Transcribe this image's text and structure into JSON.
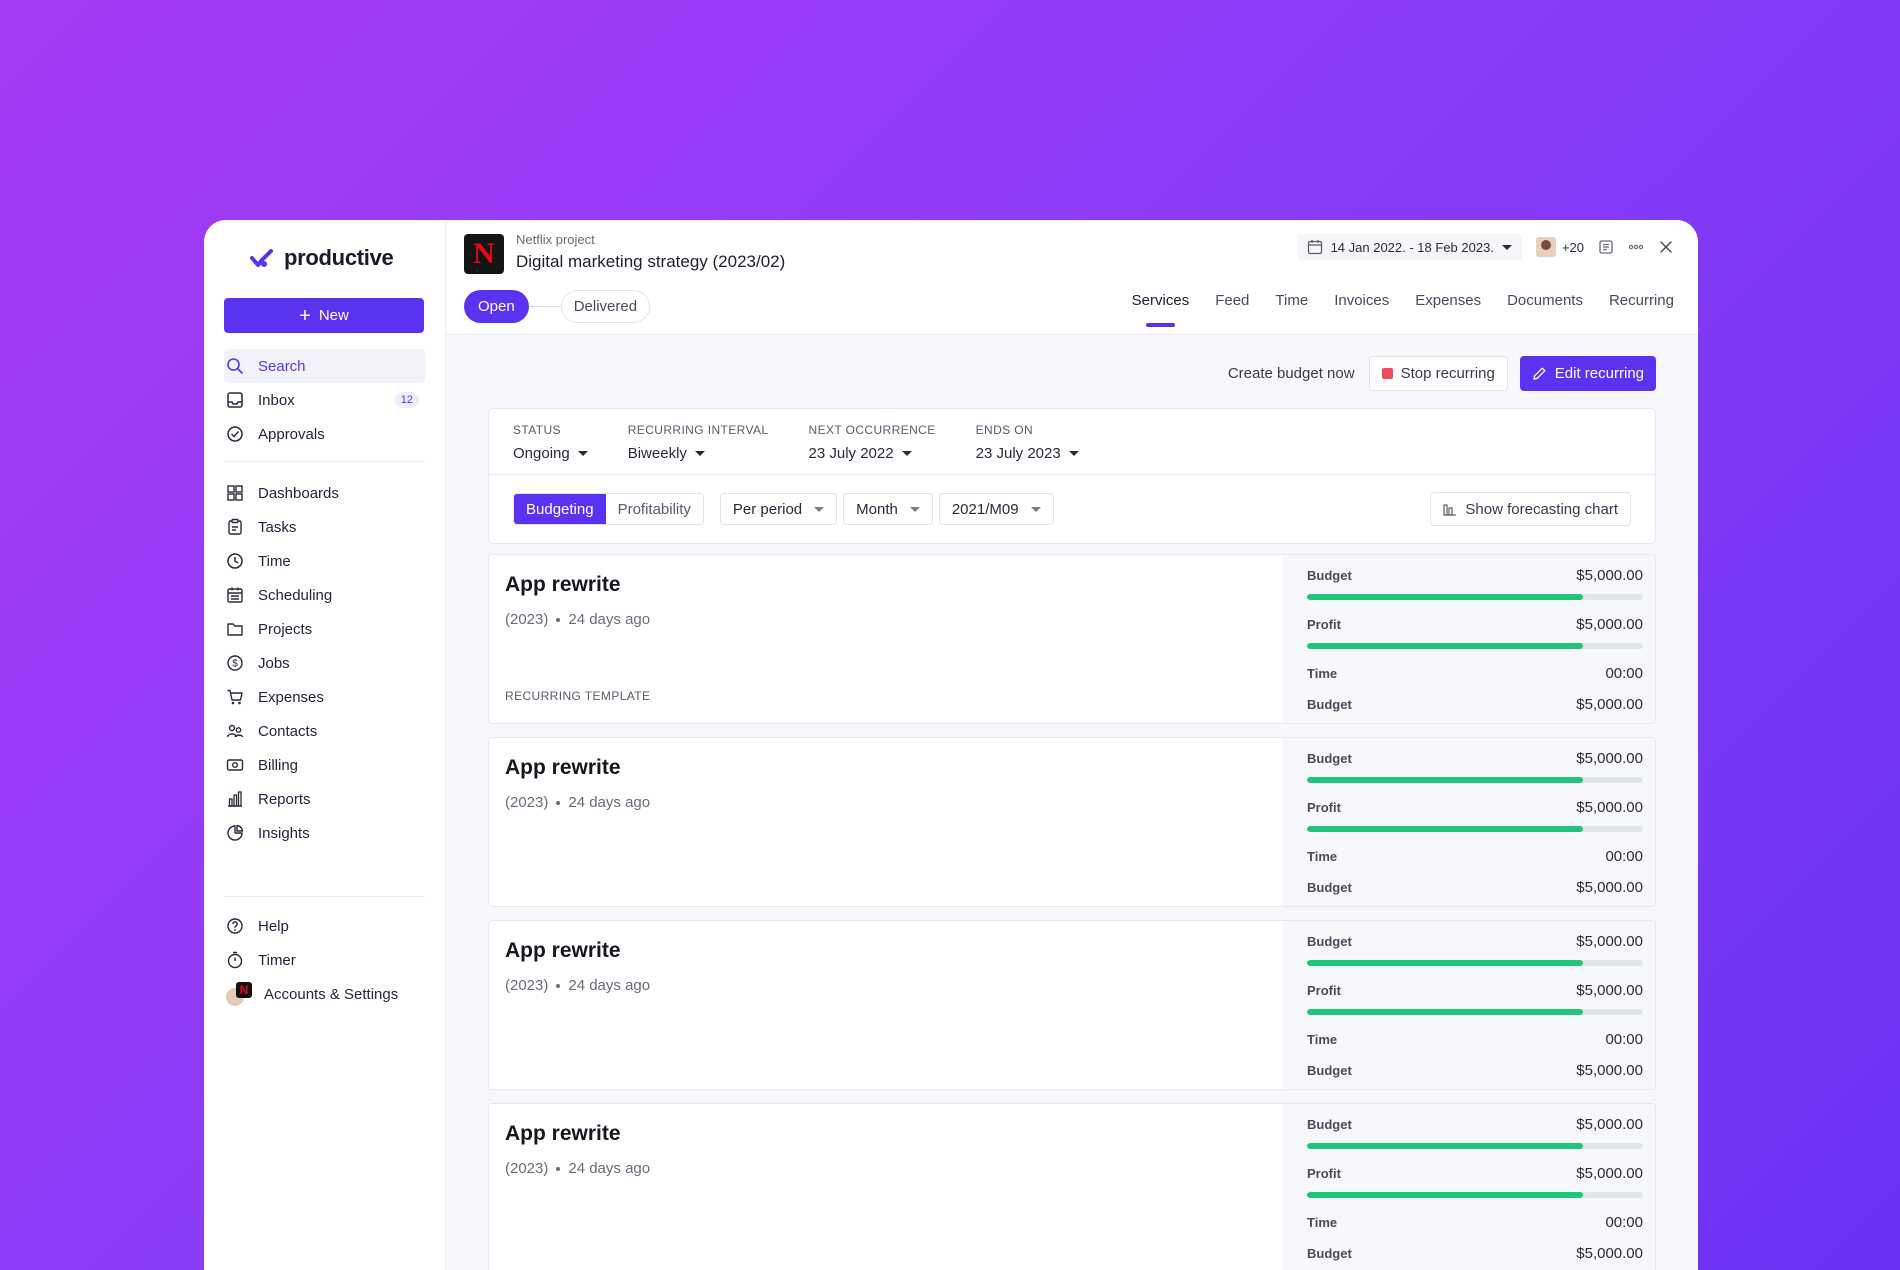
{
  "app": {
    "logo_text": "productive",
    "new_label": "New"
  },
  "sidebar": {
    "primary": [
      {
        "label": "Search",
        "icon": "search-icon"
      },
      {
        "label": "Inbox",
        "icon": "inbox-icon",
        "badge": "12"
      },
      {
        "label": "Approvals",
        "icon": "check-circle-icon"
      }
    ],
    "modules": [
      {
        "label": "Dashboards",
        "icon": "grid-icon"
      },
      {
        "label": "Tasks",
        "icon": "clipboard-icon"
      },
      {
        "label": "Time",
        "icon": "clock-icon"
      },
      {
        "label": "Scheduling",
        "icon": "calendar-icon"
      },
      {
        "label": "Projects",
        "icon": "folder-icon"
      },
      {
        "label": "Jobs",
        "icon": "dollar-icon"
      },
      {
        "label": "Expenses",
        "icon": "cart-icon"
      },
      {
        "label": "Contacts",
        "icon": "contacts-icon"
      },
      {
        "label": "Billing",
        "icon": "cash-icon"
      },
      {
        "label": "Reports",
        "icon": "bar-chart-icon"
      },
      {
        "label": "Insights",
        "icon": "pie-icon"
      }
    ],
    "bottom": [
      {
        "label": "Help",
        "icon": "help-icon"
      },
      {
        "label": "Timer",
        "icon": "stopwatch-icon"
      },
      {
        "label": "Accounts & Settings",
        "icon": "account-avatar-icon"
      }
    ]
  },
  "project": {
    "client": "Netflix project",
    "title": "Digital marketing strategy (2023/02)",
    "logo_letter": "N",
    "status_open": "Open",
    "status_delivered": "Delivered",
    "date_range": "14 Jan 2022. - 18 Feb 2023.",
    "people_count": "+20"
  },
  "tabs": [
    "Services",
    "Feed",
    "Time",
    "Invoices",
    "Expenses",
    "Documents",
    "Recurring"
  ],
  "active_tab": "Services",
  "actions": {
    "create_budget": "Create budget now",
    "stop_recurring": "Stop recurring",
    "edit_recurring": "Edit recurring"
  },
  "filters": [
    {
      "label": "STATUS",
      "value": "Ongoing"
    },
    {
      "label": "RECURRING INTERVAL",
      "value": "Biweekly"
    },
    {
      "label": "NEXT OCCURRENCE",
      "value": "23 July 2022"
    },
    {
      "label": "ENDS ON",
      "value": "23 July 2023"
    }
  ],
  "controls": {
    "seg_budgeting": "Budgeting",
    "seg_profitability": "Profitability",
    "per_period": "Per period",
    "month": "Month",
    "period": "2021/M09",
    "forecast": "Show forecasting chart"
  },
  "cards": [
    {
      "title": "App rewrite",
      "year": "(2023)",
      "ago": "24 days ago",
      "tag": "RECURRING TEMPLATE",
      "budget_label": "Budget",
      "budget_value": "$5,000.00",
      "budget_fill": 82,
      "profit_label": "Profit",
      "profit_value": "$5,000.00",
      "profit_fill": 82,
      "time_label": "Time",
      "time_value": "00:00",
      "budget2_label": "Budget",
      "budget2_value": "$5,000.00"
    },
    {
      "title": "App rewrite",
      "year": "(2023)",
      "ago": "24 days ago",
      "tag": "",
      "budget_label": "Budget",
      "budget_value": "$5,000.00",
      "budget_fill": 82,
      "profit_label": "Profit",
      "profit_value": "$5,000.00",
      "profit_fill": 82,
      "time_label": "Time",
      "time_value": "00:00",
      "budget2_label": "Budget",
      "budget2_value": "$5,000.00"
    },
    {
      "title": "App rewrite",
      "year": "(2023)",
      "ago": "24 days ago",
      "tag": "",
      "budget_label": "Budget",
      "budget_value": "$5,000.00",
      "budget_fill": 82,
      "profit_label": "Profit",
      "profit_value": "$5,000.00",
      "profit_fill": 82,
      "time_label": "Time",
      "time_value": "00:00",
      "budget2_label": "Budget",
      "budget2_value": "$5,000.00"
    },
    {
      "title": "App rewrite",
      "year": "(2023)",
      "ago": "24 days ago",
      "tag": "",
      "budget_label": "Budget",
      "budget_value": "$5,000.00",
      "budget_fill": 82,
      "profit_label": "Profit",
      "profit_value": "$5,000.00",
      "profit_fill": 82,
      "time_label": "Time",
      "time_value": "00:00",
      "budget2_label": "Budget",
      "budget2_value": "$5,000.00"
    }
  ],
  "colors": {
    "accent": "#5b32f0",
    "progress": "#22c37a",
    "stop": "#ee4b5c",
    "netflix_red": "#e50914"
  }
}
